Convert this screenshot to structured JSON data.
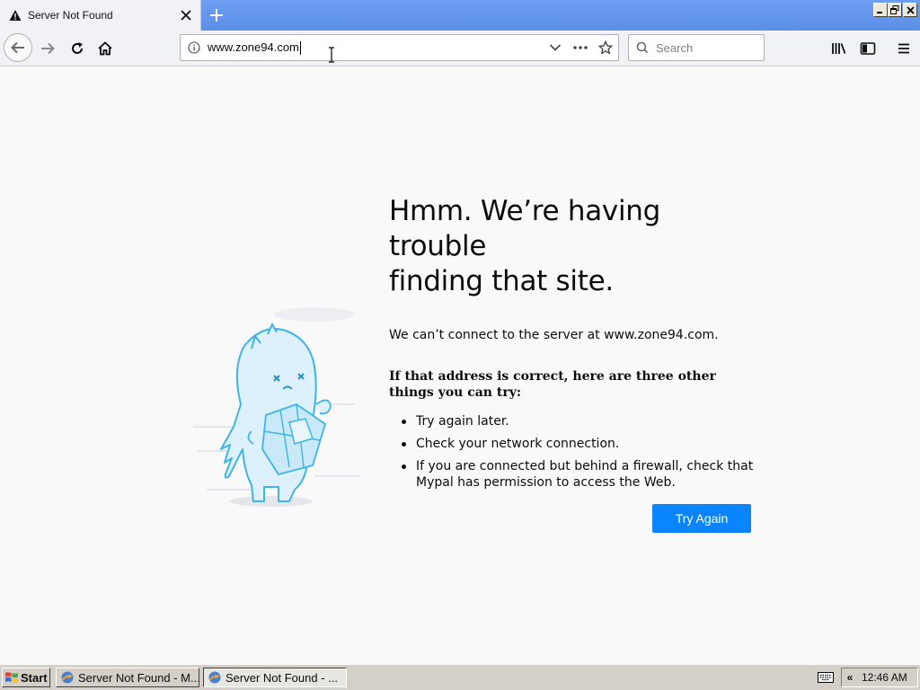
{
  "tab": {
    "title": "Server Not Found"
  },
  "navbar": {
    "url": "www.zone94.com",
    "search_placeholder": "Search"
  },
  "error": {
    "title_line1": "Hmm. We’re having trouble",
    "title_line2": "finding that site.",
    "message": "We can’t connect to the server at www.zone94.com.",
    "hint": "If that address is correct, here are three other things you can try:",
    "suggestions": [
      "Try again later.",
      "Check your network connection.",
      "If you are connected but behind a firewall, check that Mypal has permission to access the Web."
    ],
    "button_label": "Try Again"
  },
  "taskbar": {
    "start_label": "Start",
    "tasks": [
      "Server Not Found - M...",
      "Server Not Found - ..."
    ],
    "clock": "12:46 AM"
  },
  "colors": {
    "accent": "#0a84ff",
    "tabbar": "#6c9ff2"
  }
}
